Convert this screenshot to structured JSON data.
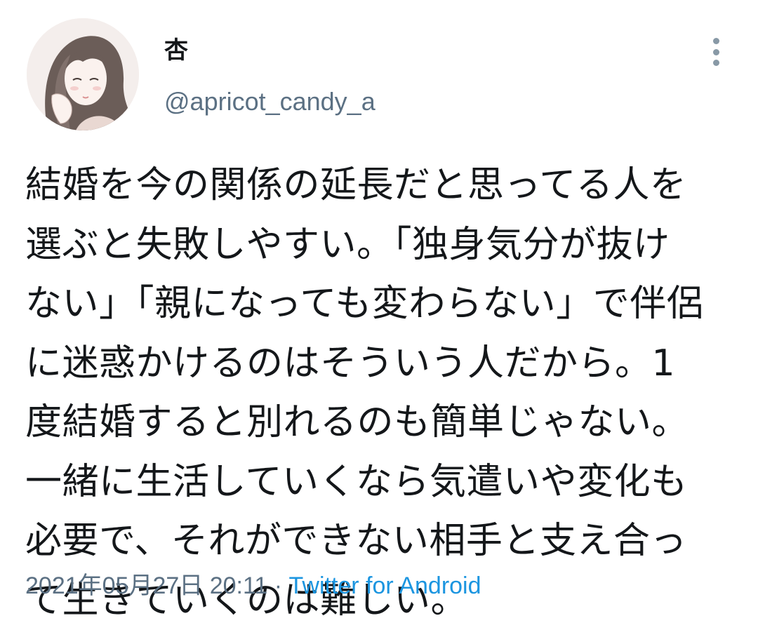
{
  "user": {
    "display_name": "杏",
    "handle": "@apricot_candy_a",
    "avatar_icon": "illustrated-girl-avatar"
  },
  "tweet": {
    "lines": [
      "結婚を今の関係の延長だと思ってる人を",
      "選ぶと失敗しやすい。「独身気分が抜け",
      "ない」「親になっても変わらない」で伴侶",
      "に迷惑かけるのはそういう人だから。1",
      "度結婚すると別れるのも簡単じゃない。",
      "一緒に生活していくなら気遣いや変化も",
      "必要で、それができない相手と支え合っ",
      "て生きていくのは難しい。"
    ]
  },
  "meta": {
    "timestamp": "2021年05月27日 20:11",
    "separator": " · ",
    "source": "Twitter for Android"
  },
  "menu": {
    "more_icon": "vertical-ellipsis-icon"
  },
  "colors": {
    "text": "#14171a",
    "secondary": "#5b7083",
    "link": "#1b95e0",
    "icon": "#8899a6"
  }
}
